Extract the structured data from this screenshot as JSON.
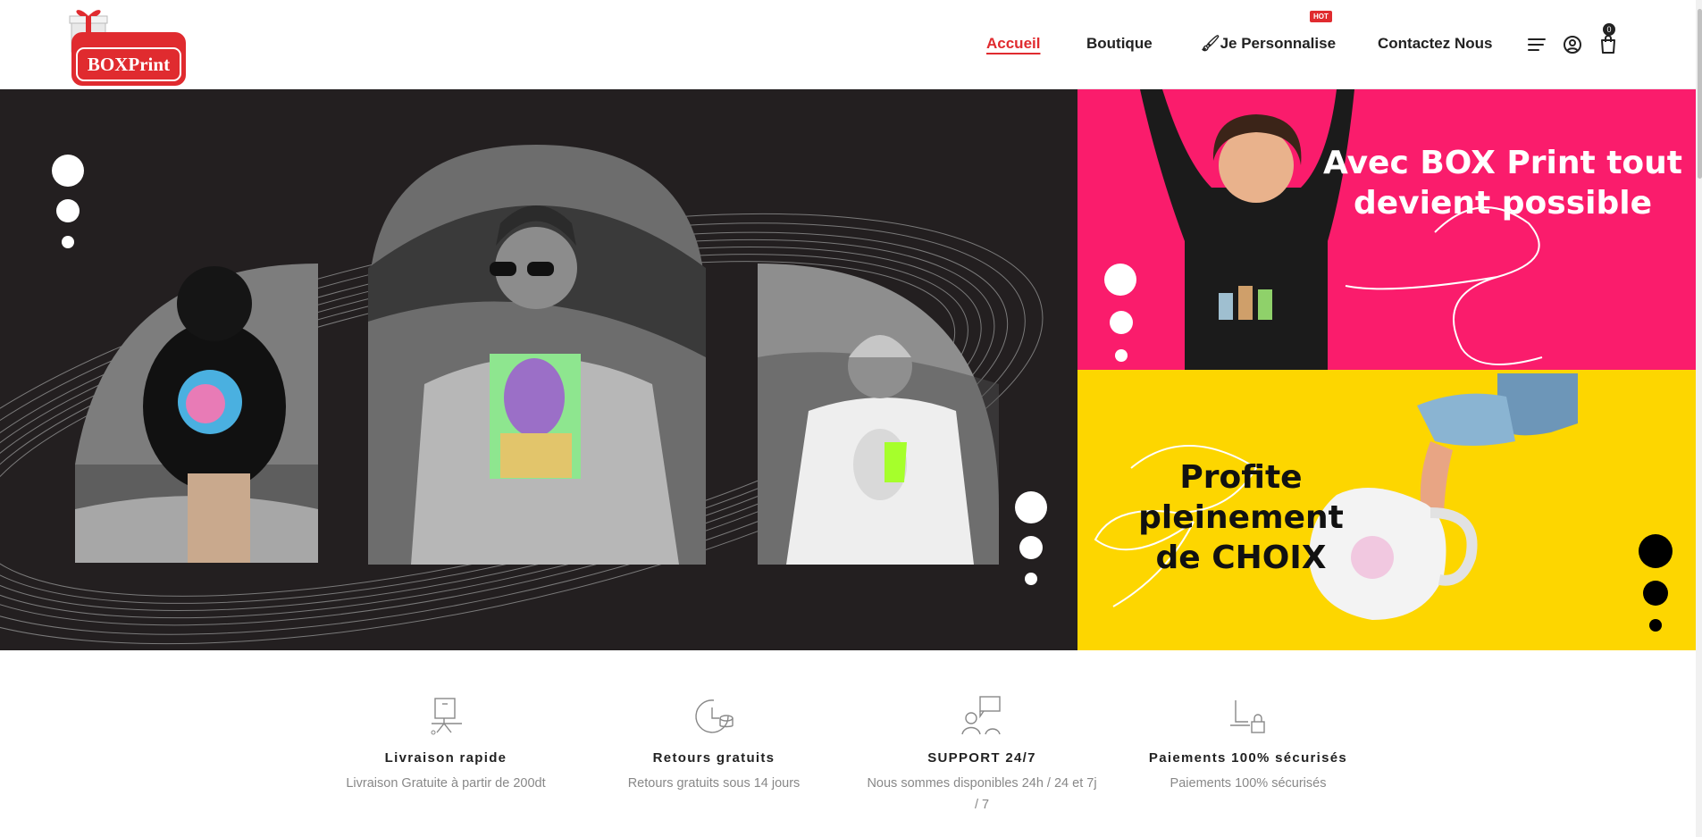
{
  "brand": {
    "logo_text": "BOXPrint"
  },
  "nav": {
    "items": [
      {
        "label": "Accueil"
      },
      {
        "label": "Boutique"
      },
      {
        "label": "🖌Je Personnalise"
      },
      {
        "label": "Contactez Nous"
      }
    ],
    "hot_badge": "HOT"
  },
  "header_icons": [
    "menu-icon",
    "user-icon",
    "shopping-bag-icon"
  ],
  "cart": {
    "count": "0"
  },
  "hero": {
    "banner_top": {
      "title_line1": "Avec BOX Print tout",
      "title_line2": "devient possible"
    },
    "banner_bottom": {
      "title_line1": "Profite pleinement",
      "title_line2": "de CHOIX"
    }
  },
  "features": [
    {
      "icon": "delivery-icon",
      "title": "Livraison rapide",
      "description": "Livraison Gratuite à partir de 200dt"
    },
    {
      "icon": "returns-icon",
      "title": "Retours gratuits",
      "description": "Retours gratuits sous 14 jours"
    },
    {
      "icon": "support-icon",
      "title": "SUPPORT 24/7",
      "description": "Nous sommes disponibles 24h / 24 et 7j / 7"
    },
    {
      "icon": "secure-payment-icon",
      "title": "Paiements 100% sécurisés",
      "description": "Paiements 100% sécurisés"
    }
  ],
  "colors": {
    "accent": "#e02b2f",
    "hero_dark": "#231f20",
    "hero_pink": "#fa1c6c",
    "hero_yellow": "#fdd600"
  }
}
